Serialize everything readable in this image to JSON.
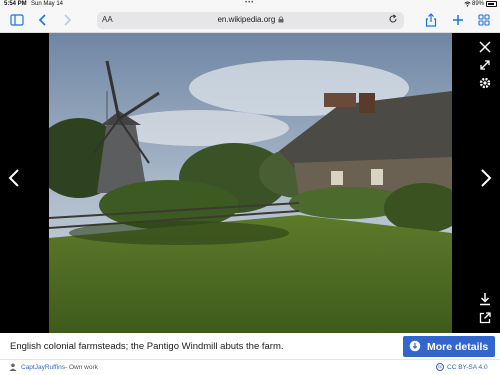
{
  "status": {
    "time": "5:54 PM",
    "date": "Sun May 14",
    "battery": "89%",
    "battery_level": 0.89
  },
  "toolbar": {
    "text_size_label": "AA",
    "url": "en.wikipedia.org"
  },
  "caption": {
    "text": "English colonial farmsteads; the Pantigo Windmill abuts the farm.",
    "more_details": "More details"
  },
  "attribution": {
    "author": "CaptJayRuffins",
    "source": "- Own work",
    "license": "CC BY-SA 4.0"
  },
  "icons": {
    "sidebar": "sidebar-icon",
    "back": "chevron-left-icon",
    "forward": "chevron-right-icon",
    "lock": "lock-icon",
    "reload": "reload-icon",
    "share": "share-icon",
    "new_tab": "plus-icon",
    "tabs": "tabs-grid-icon",
    "close": "close-icon",
    "fullscreen": "expand-icon",
    "settings": "gear-icon",
    "download": "download-icon",
    "external": "external-link-icon"
  }
}
